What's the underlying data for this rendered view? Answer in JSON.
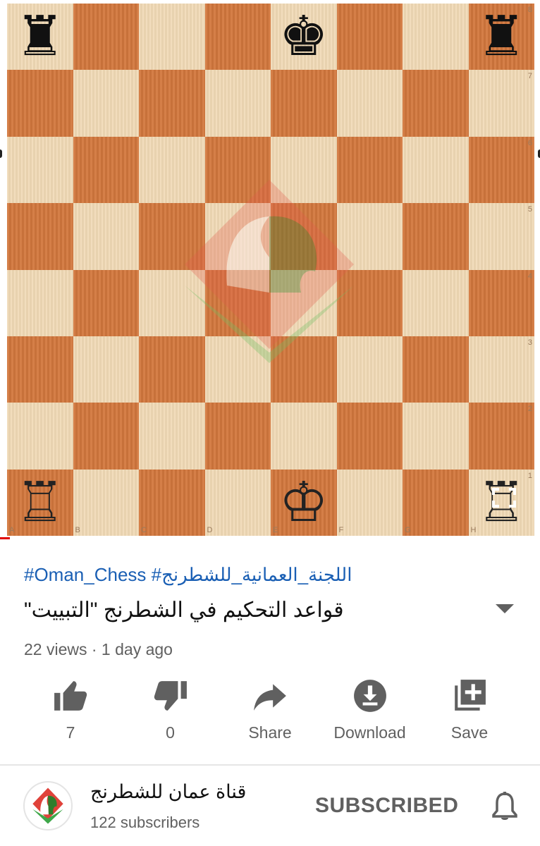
{
  "video": {
    "board": {
      "ranks": [
        "8",
        "7",
        "6",
        "5",
        "4",
        "3",
        "2",
        "1"
      ],
      "files": [
        "A",
        "B",
        "C",
        "D",
        "E",
        "F",
        "G",
        "H"
      ],
      "pieces": [
        {
          "square": "a8",
          "piece": "black-rook",
          "glyph": "♜",
          "color": "#111111"
        },
        {
          "square": "e8",
          "piece": "black-king",
          "glyph": "♚",
          "color": "#111111"
        },
        {
          "square": "h8",
          "piece": "black-rook",
          "glyph": "♜",
          "color": "#111111"
        },
        {
          "square": "a1",
          "piece": "white-rook",
          "glyph": "♖",
          "color": "#222222"
        },
        {
          "square": "e1",
          "piece": "white-king",
          "glyph": "♔",
          "color": "#222222"
        },
        {
          "square": "h1",
          "piece": "white-rook",
          "glyph": "♖",
          "color": "#222222"
        }
      ],
      "colors": {
        "light": "#f0d9b5",
        "dark": "#d2773d"
      }
    }
  },
  "meta": {
    "hashtags": "#Oman_Chess #اللجنة_العمانية_للشطرنج",
    "title": "قواعد التحكيم في الشطرنج \"التبييت\"",
    "stats": "22 views · 1 day ago",
    "expand_icon": "chevron-down-icon"
  },
  "actions": [
    {
      "id": "like",
      "label": "7",
      "icon": "thumb-up-icon"
    },
    {
      "id": "dislike",
      "label": "0",
      "icon": "thumb-down-icon"
    },
    {
      "id": "share",
      "label": "Share",
      "icon": "share-icon"
    },
    {
      "id": "download",
      "label": "Download",
      "icon": "download-icon"
    },
    {
      "id": "save",
      "label": "Save",
      "icon": "playlist-add-icon"
    }
  ],
  "channel": {
    "name": "قناة عمان للشطرنج",
    "subscribers": "122 subscribers",
    "subscribe_label": "SUBSCRIBED",
    "bell_icon": "bell-icon"
  },
  "colors": {
    "link": "#1a5fb4",
    "muted": "#606060",
    "progress": "#e10000"
  }
}
